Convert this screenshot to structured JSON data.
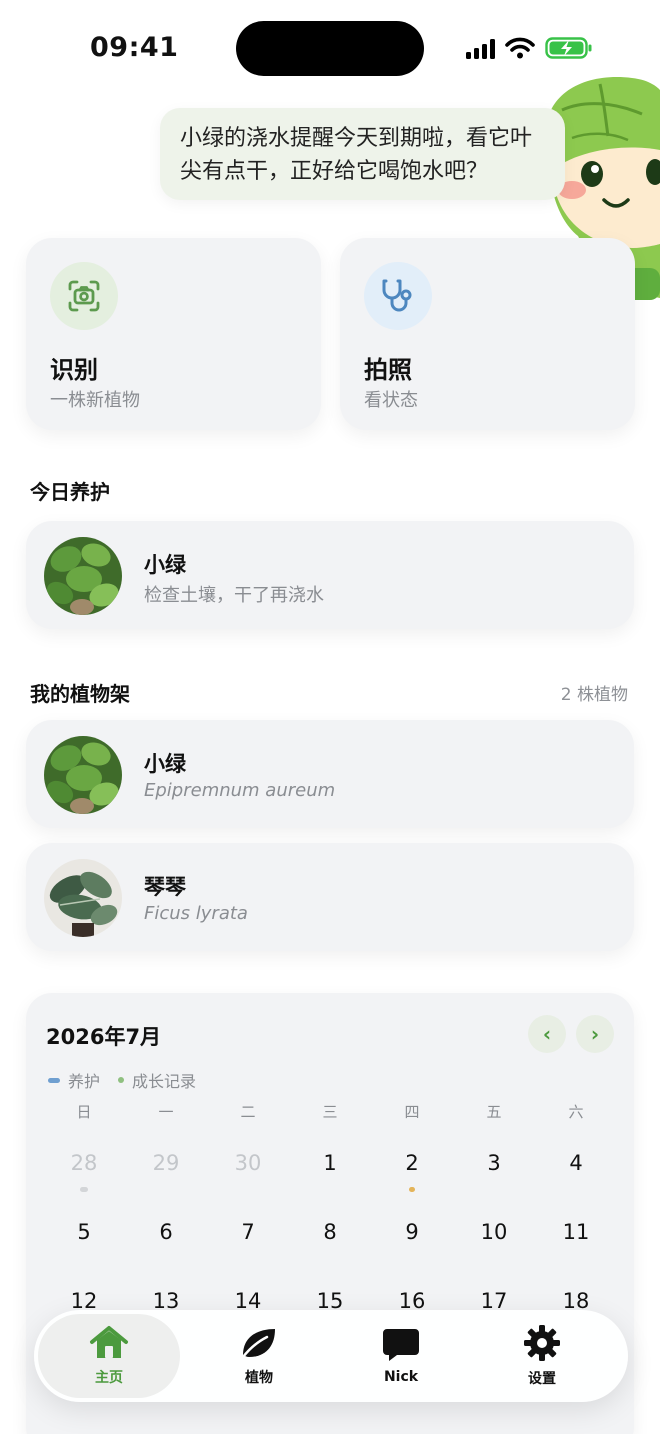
{
  "status_bar": {
    "time": "09:41"
  },
  "mascot": {
    "message": "小绿的浇水提醒今天到期啦，看它叶尖有点干，正好给它喝饱水吧？"
  },
  "actions": [
    {
      "title": "识别",
      "subtitle": "一株新植物",
      "icon": "camera-scan-icon",
      "icon_bg": "#e4efdf",
      "icon_color": "#5c9a4e"
    },
    {
      "title": "拍照",
      "subtitle": "看状态",
      "icon": "stethoscope-icon",
      "icon_bg": "#e2eef9",
      "icon_color": "#4d87bf"
    }
  ],
  "today_care": {
    "title": "今日养护",
    "items": [
      {
        "name": "小绿",
        "note": "检查土壤，干了再浇水"
      }
    ]
  },
  "shelf": {
    "title": "我的植物架",
    "count": "2 株植物",
    "plants": [
      {
        "name": "小绿",
        "latin": "Epipremnum aureum"
      },
      {
        "name": "琴琴",
        "latin": "Ficus lyrata"
      }
    ]
  },
  "calendar": {
    "title": "2026年7月",
    "prev": "‹",
    "next": "›",
    "legend": [
      {
        "label": "养护",
        "color": "#6f9fd0"
      },
      {
        "label": "成长记录",
        "color": "#8fc080"
      }
    ],
    "weekdays": [
      "日",
      "一",
      "二",
      "三",
      "四",
      "五",
      "六"
    ],
    "weeks": [
      [
        "28",
        "29",
        "30",
        "1",
        "2",
        "3",
        "4"
      ],
      [
        "5",
        "6",
        "7",
        "8",
        "9",
        "10",
        "11"
      ],
      [
        "12",
        "13",
        "14",
        "15",
        "16",
        "17",
        "18"
      ]
    ]
  },
  "tabbar": {
    "tabs": [
      {
        "label": "主页",
        "icon": "home-icon",
        "active": true
      },
      {
        "label": "植物",
        "icon": "leaf-icon",
        "active": false
      },
      {
        "label": "Nick",
        "icon": "chat-bubble-icon",
        "active": false
      },
      {
        "label": "设置",
        "icon": "gear-icon",
        "active": false
      }
    ]
  },
  "colors": {
    "accent": "#4c9a3e",
    "card": "#f2f3f5",
    "muted": "#8a8d92"
  }
}
